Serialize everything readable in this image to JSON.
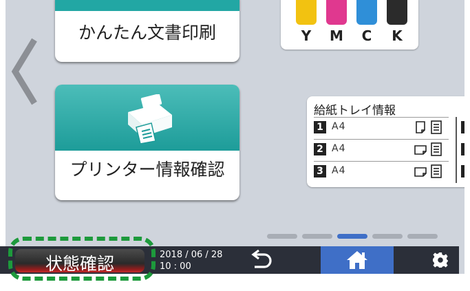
{
  "tiles": {
    "easy_print": {
      "label": "かんたん文書印刷"
    },
    "printer_info": {
      "label": "プリンター情報確認"
    }
  },
  "ink": [
    {
      "label": "Y",
      "color": "#f2c211"
    },
    {
      "label": "M",
      "color": "#e0388f"
    },
    {
      "label": "C",
      "color": "#2f8fd8"
    },
    {
      "label": "K",
      "color": "#2b2b2b"
    }
  ],
  "tray": {
    "title": "給紙トレイ情報",
    "rows": [
      {
        "number": "1",
        "size": "A4",
        "paper_icon": "paper-portrait-icon",
        "level_icon": "paper-level-icon"
      },
      {
        "number": "2",
        "size": "A4",
        "paper_icon": "paper-landscape-icon",
        "level_icon": "paper-level-icon"
      },
      {
        "number": "3",
        "size": "A4",
        "paper_icon": "paper-landscape-icon",
        "level_icon": "paper-level-icon"
      }
    ]
  },
  "page_indicator": {
    "count": 5,
    "active_index": 2
  },
  "bottom_bar": {
    "status_label": "状態確認",
    "date": "2018 / 06 / 28",
    "time": "10 : 00",
    "home_color": "#3f6fc7",
    "highlight_color": "#1d9a3c"
  },
  "icons": {
    "back": "chevron-left-icon",
    "printer": "printer-icon",
    "return": "return-arrow-icon",
    "home": "home-icon",
    "settings": "gear-icon"
  }
}
